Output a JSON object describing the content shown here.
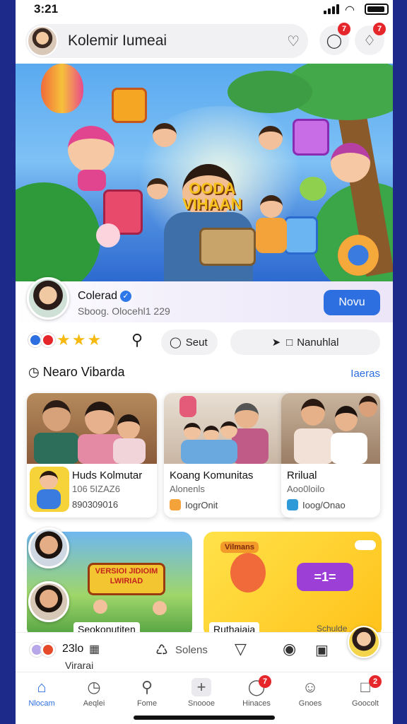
{
  "status": {
    "time": "3:21"
  },
  "header": {
    "search_title": "Kolemir Iumeai",
    "notif_badge_1": "7",
    "notif_badge_2": "7"
  },
  "banner": {
    "logo_line1": "OODA",
    "logo_line2": "VIHAAN"
  },
  "channel": {
    "name": "Colerad",
    "meta": "Sboog. Olocehl1 229",
    "now_button": "Novu"
  },
  "actions": {
    "sort_label": "Seut",
    "share_label": "Nanuhlal"
  },
  "section": {
    "title": "Nearo Vibarda",
    "more_link": "Iaeras"
  },
  "cards": [
    {
      "title": "Huds Kolmutar",
      "subtitle": "106 5IZAZ6",
      "meta": "890309016"
    },
    {
      "title": "Koang Komunitas",
      "subtitle": "Alonenls",
      "meta": "IogrOnit"
    },
    {
      "title": "Rrilual",
      "subtitle": "Aoo0loilo",
      "meta": "Ioog/Onao"
    }
  ],
  "promos": [
    {
      "title": "Seokonutiten",
      "art_text": "VERSIOI JIDIOIM LWIRIAD"
    },
    {
      "title": "Ruthaiaia",
      "corner": "Schulde",
      "tag": "Vilmans",
      "badge": "=1="
    }
  ],
  "mini_player": {
    "count": "23lo",
    "sub": "Virarai",
    "label": "Solens"
  },
  "tabs": [
    {
      "label": "Nlocam",
      "icon": "home-icon"
    },
    {
      "label": "Aeqlei",
      "icon": "clock-icon"
    },
    {
      "label": "Fome",
      "icon": "search-icon"
    },
    {
      "label": "Snoooe",
      "icon": "plus-icon"
    },
    {
      "label": "Hinaces",
      "icon": "chat-icon",
      "badge": "7"
    },
    {
      "label": "Gnoes",
      "icon": "person-icon"
    },
    {
      "label": "Goocolt",
      "icon": "bag-icon",
      "badge": "2"
    }
  ],
  "colors": {
    "accent": "#2d6fe0",
    "badge": "#e5262b",
    "star": "#f6b90f"
  }
}
